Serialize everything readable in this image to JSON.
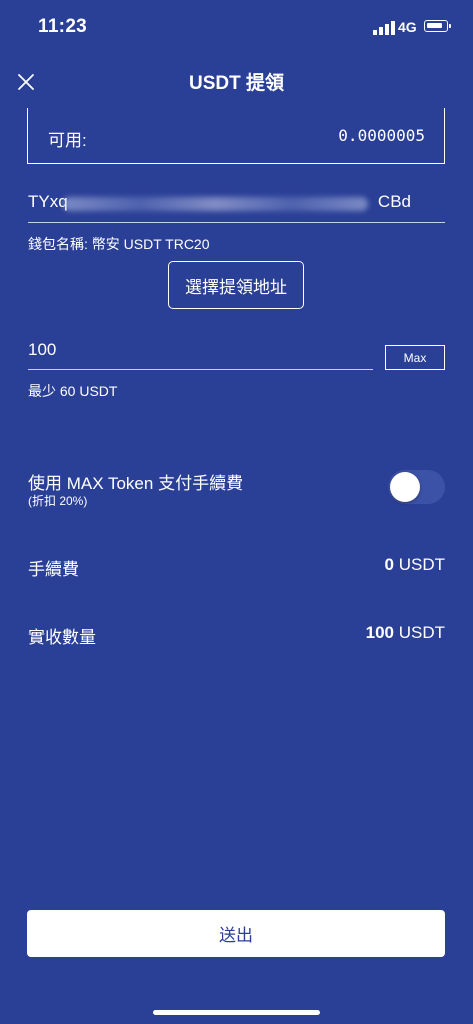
{
  "status_bar": {
    "time": "11:23",
    "network": "4G"
  },
  "header": {
    "title": "USDT 提領"
  },
  "available": {
    "label": "可用:",
    "value": "0.0000005"
  },
  "address": {
    "start": "TYxq",
    "end": "CBd"
  },
  "wallet": {
    "label": "錢包名稱: 幣安 USDT TRC20"
  },
  "select_address_button": "選擇提領地址",
  "amount": {
    "value": "100",
    "max_label": "Max",
    "min_note": "最少 60 USDT"
  },
  "max_token": {
    "label": "使用 MAX Token 支付手續費",
    "sub": "(折扣 20%)",
    "enabled": false
  },
  "fee": {
    "label": "手續費",
    "value": "0",
    "unit": " USDT"
  },
  "receive": {
    "label": "實收數量",
    "value": "100",
    "unit": " USDT"
  },
  "submit_button": "送出",
  "colors": {
    "background": "#2a3f96",
    "text": "#ffffff",
    "toggle_off": "#3c52a6"
  }
}
